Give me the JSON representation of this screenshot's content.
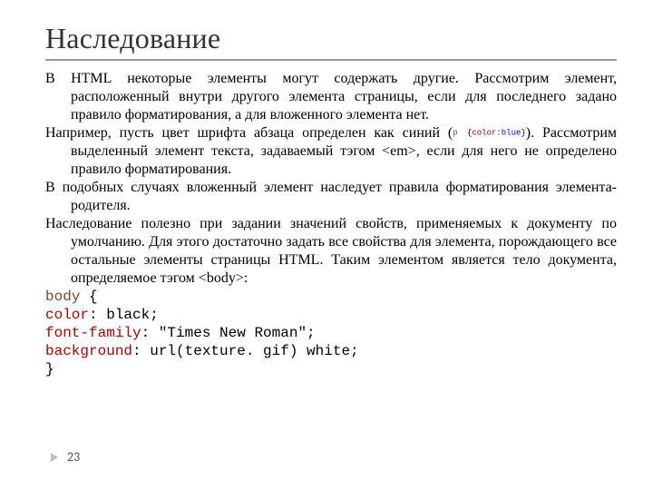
{
  "title": "Наследование",
  "body": {
    "p1": "В HTML некоторые элементы могут содержать другие. Рассмотрим элемент, расположенный внутри другого элемента страницы, если для последнего задано правило форматирования, а для вложенного элемента нет.",
    "p2_a": "Например, пусть цвет шрифта абзаца определен как синий (",
    "p2_code_sel": "p",
    "p2_code_brace1": "{",
    "p2_code_prop": "color:",
    "p2_code_val": "blue",
    "p2_code_brace2": "}",
    "p2_b": "). Рассмотрим выделенный элемент текста, задаваемый тэгом <em>, если для него не определено правило форматирования.",
    "p3": "В подобных случаях вложенный элемент наследует правила форматирования элемента-родителя.",
    "p4": "Наследование полезно при задании значений свойств, применяемых к документу по умолчанию. Для этого достаточно задать все свойства для элемента, порождающего все остальные элементы страницы HTML. Таким элементом является тело документа, определяемое тэгом <body>:"
  },
  "code": {
    "l1_sel": "body",
    "l1_rest": " {",
    "l2_prop": "color",
    "l2_rest": ": black;",
    "l3_prop": "font-family",
    "l3_rest": ": \"Times New Roman\";",
    "l4_prop": "background",
    "l4_rest": ": url(texture. gif) white;",
    "l5": "}"
  },
  "footer": {
    "page": "23"
  }
}
